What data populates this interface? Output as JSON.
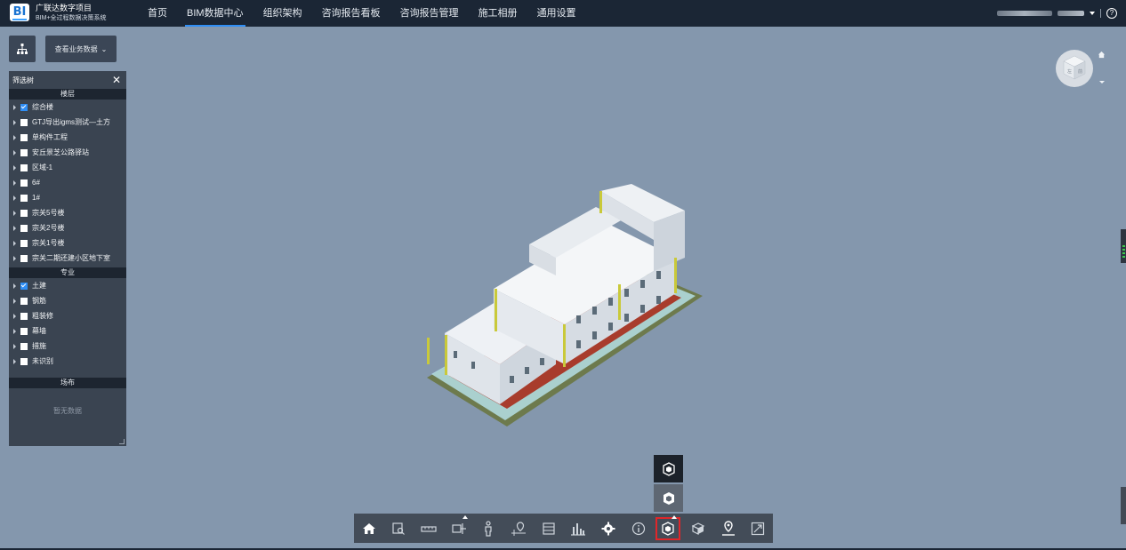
{
  "header": {
    "logo_text": "BI",
    "project_name": "广联达数字项目",
    "system_name": "BIM+全过程数据决策系统",
    "nav": [
      {
        "label": "首页",
        "active": false
      },
      {
        "label": "BIM数据中心",
        "active": true
      },
      {
        "label": "组织架构",
        "active": false
      },
      {
        "label": "咨询报告看板",
        "active": false
      },
      {
        "label": "咨询报告管理",
        "active": false
      },
      {
        "label": "施工相册",
        "active": false
      },
      {
        "label": "通用设置",
        "active": false
      }
    ],
    "help_label": "?"
  },
  "left_controls": {
    "business_button_label": "查看业务数据",
    "business_button_caret": "⌄"
  },
  "filter_panel": {
    "title": "筛选树",
    "close_label": "✕",
    "floors_title": "楼层",
    "floors": [
      {
        "label": "综合楼",
        "checked": true
      },
      {
        "label": "GTJ导出igms测试—土方",
        "checked": false
      },
      {
        "label": "单构件工程",
        "checked": false
      },
      {
        "label": "安丘景芝公路驿站",
        "checked": false
      },
      {
        "label": "区域-1",
        "checked": false
      },
      {
        "label": "6#",
        "checked": false
      },
      {
        "label": "1#",
        "checked": false
      },
      {
        "label": "宗关5号楼",
        "checked": false
      },
      {
        "label": "宗关2号楼",
        "checked": false
      },
      {
        "label": "宗关1号楼",
        "checked": false
      },
      {
        "label": "宗关二期还建小区地下室",
        "checked": false
      }
    ],
    "disciplines_title": "专业",
    "disciplines": [
      {
        "label": "土建",
        "checked": true
      },
      {
        "label": "钢筋",
        "checked": false
      },
      {
        "label": "粗装修",
        "checked": false
      },
      {
        "label": "幕墙",
        "checked": false
      },
      {
        "label": "措施",
        "checked": false
      },
      {
        "label": "未识别",
        "checked": false
      }
    ],
    "site_title": "场布",
    "site_empty": "暂无数据"
  },
  "toolbar": {
    "buttons": [
      "home-icon",
      "zoom-box-icon",
      "measure-icon",
      "section-icon",
      "walk-person-icon",
      "location-pin-icon",
      "list-icon",
      "chart-icon",
      "settings-icon",
      "info-icon",
      "render-mode-icon",
      "cube-icon",
      "map-marker-icon",
      "fullscreen-icon"
    ],
    "selected_index": 10
  },
  "colors": {
    "viewport_bg": "#8497ad",
    "topbar_bg": "#1b2635",
    "panel_bg": "#3a4451",
    "accent": "#2f8ef5",
    "selected_outline": "#e0262a"
  }
}
